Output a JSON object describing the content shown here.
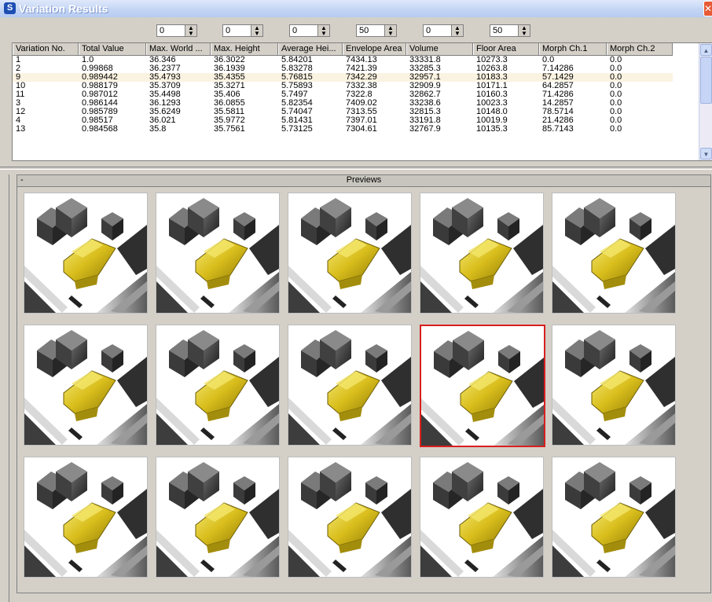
{
  "window": {
    "title": "Variation Results",
    "icon": "app-logo-icon",
    "close_icon": "close-icon"
  },
  "spinners": [
    "0",
    "0",
    "0",
    "50",
    "0",
    "50"
  ],
  "table": {
    "columns": [
      "Variation No.",
      "Total Value",
      "Max. World ...",
      "Max. Height",
      "Average Hei...",
      "Envelope Area",
      "Volume",
      "Floor Area",
      "Morph Ch.1",
      "Morph Ch.2"
    ],
    "rows": [
      [
        "1",
        "1.0",
        "36.346",
        "36.3022",
        "5.84201",
        "7434.13",
        "33331.8",
        "10273.3",
        "0.0",
        "0.0"
      ],
      [
        "2",
        "0.99868",
        "36.2377",
        "36.1939",
        "5.83278",
        "7421.39",
        "33285.3",
        "10263.8",
        "7.14286",
        "0.0"
      ],
      [
        "9",
        "0.989442",
        "35.4793",
        "35.4355",
        "5.76815",
        "7342.29",
        "32957.1",
        "10183.3",
        "57.1429",
        "0.0"
      ],
      [
        "10",
        "0.988179",
        "35.3709",
        "35.3271",
        "5.75893",
        "7332.38",
        "32909.9",
        "10171.1",
        "64.2857",
        "0.0"
      ],
      [
        "11",
        "0.987012",
        "35.4498",
        "35.406",
        "5.7497",
        "7322.8",
        "32862.7",
        "10160.3",
        "71.4286",
        "0.0"
      ],
      [
        "3",
        "0.986144",
        "36.1293",
        "36.0855",
        "5.82354",
        "7409.02",
        "33238.6",
        "10023.3",
        "14.2857",
        "0.0"
      ],
      [
        "12",
        "0.985789",
        "35.6249",
        "35.5811",
        "5.74047",
        "7313.55",
        "32815.3",
        "10148.0",
        "78.5714",
        "0.0"
      ],
      [
        "4",
        "0.98517",
        "36.021",
        "35.9772",
        "5.81431",
        "7397.01",
        "33191.8",
        "10019.9",
        "21.4286",
        "0.0"
      ],
      [
        "13",
        "0.984568",
        "35.8",
        "35.7561",
        "5.73125",
        "7304.61",
        "32767.9",
        "10135.3",
        "85.7143",
        "0.0"
      ]
    ],
    "highlight_row": 2
  },
  "previews": {
    "title": "Previews",
    "toggle": "-",
    "tile_count": 15,
    "selected_index": 8,
    "selected_color": "#d81f1f"
  }
}
